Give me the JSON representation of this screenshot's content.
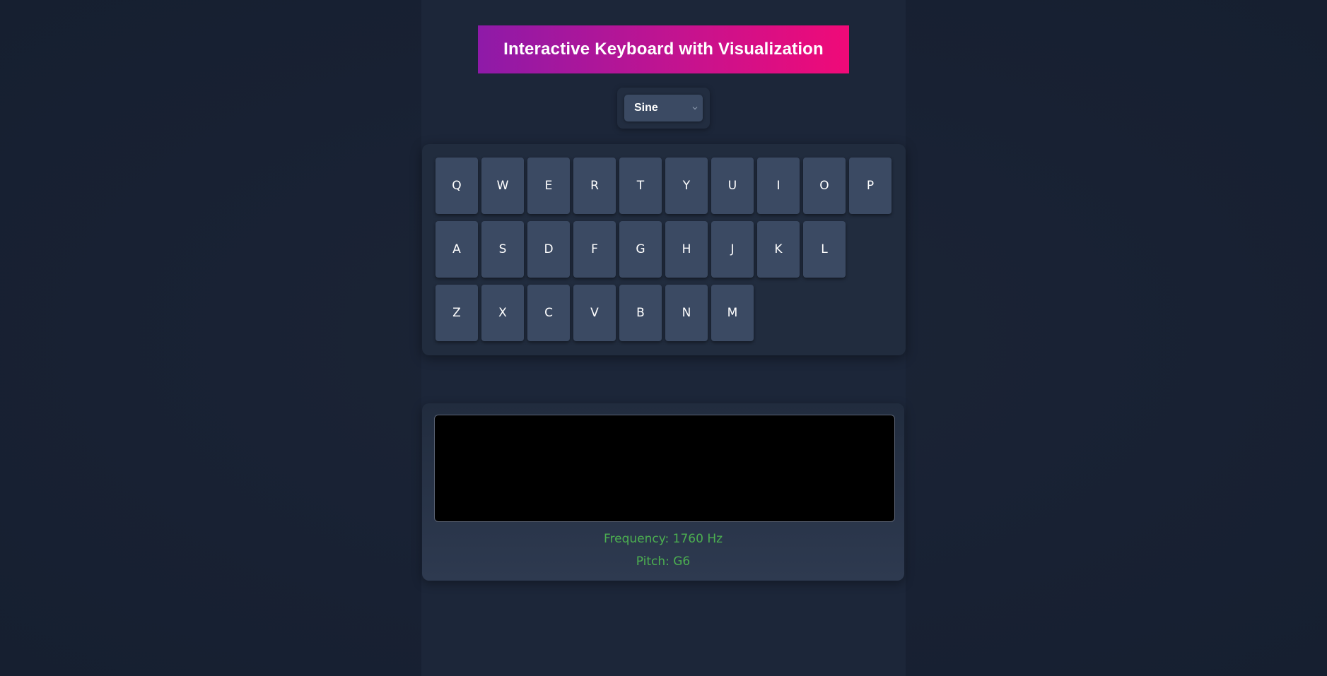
{
  "header": {
    "title": "Interactive Keyboard with Visualization"
  },
  "waveform_select": {
    "selected": "Sine"
  },
  "keyboard": {
    "rows": [
      [
        "Q",
        "W",
        "E",
        "R",
        "T",
        "Y",
        "U",
        "I",
        "O",
        "P"
      ],
      [
        "A",
        "S",
        "D",
        "F",
        "G",
        "H",
        "J",
        "K",
        "L"
      ],
      [
        "Z",
        "X",
        "C",
        "V",
        "B",
        "N",
        "M"
      ]
    ]
  },
  "visualization": {
    "frequency_text": "Frequency: 1760 Hz",
    "pitch_text": "Pitch: G6"
  },
  "colors": {
    "background": "#182133",
    "key": "#3b4a63",
    "accent_start": "#8e1aa8",
    "accent_end": "#f00a78",
    "info_text": "#4caf50"
  },
  "icons": {
    "select_arrow": "chevron-down-icon"
  }
}
